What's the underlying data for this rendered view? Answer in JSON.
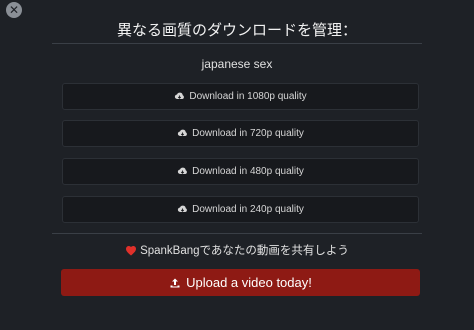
{
  "close": {
    "glyph": "✕",
    "icon": "close-icon"
  },
  "modal_title": "異なる画質のダウンロードを管理：",
  "video_title": "japanese sex",
  "downloads": [
    {
      "label": "Download in 1080p quality",
      "icon": "cloud-download-icon"
    },
    {
      "label": "Download in 720p quality",
      "icon": "cloud-download-icon"
    },
    {
      "label": "Download in 480p quality",
      "icon": "cloud-download-icon"
    },
    {
      "label": "Download in 240p quality",
      "icon": "cloud-download-icon"
    }
  ],
  "share": {
    "text": "SpankBangであなたの動画を共有しよう",
    "icon": "heart-icon",
    "icon_color": "#e0302a"
  },
  "upload": {
    "label": "Upload a video today!",
    "icon": "upload-icon",
    "bg_color": "#8e1a14"
  }
}
